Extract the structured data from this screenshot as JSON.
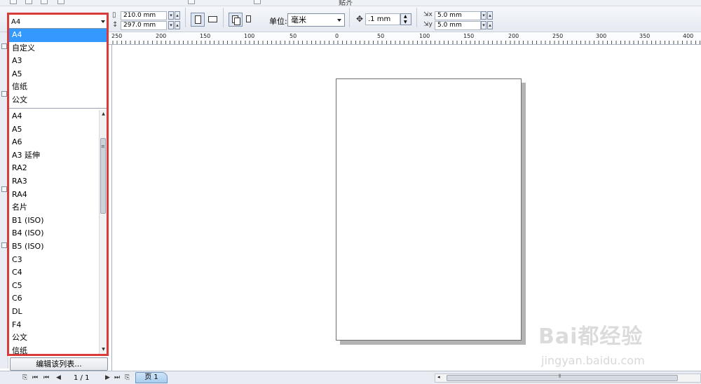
{
  "top_toolbar": {
    "partial_text": "贴齐"
  },
  "property_bar": {
    "paper_size_value": "A4",
    "width_value": "210.0 mm",
    "height_value": "297.0 mm",
    "units_label": "单位:",
    "units_value": "毫米",
    "nudge_value": ".1 mm",
    "dup_x_value": "5.0 mm",
    "dup_y_value": "5.0 mm"
  },
  "ruler": {
    "labels": [
      "250",
      "200",
      "150",
      "100",
      "50",
      "0",
      "50",
      "100",
      "150",
      "200",
      "250",
      "300",
      "350",
      "400"
    ]
  },
  "paper_dropdown": {
    "current_value": "A4",
    "recent_items": [
      {
        "label": "A4",
        "selected": true
      },
      {
        "label": "自定义",
        "selected": false
      },
      {
        "label": "A3",
        "selected": false
      },
      {
        "label": "A5",
        "selected": false
      },
      {
        "label": "信纸",
        "selected": false
      },
      {
        "label": "公文",
        "selected": false
      }
    ],
    "all_items": [
      "A4",
      "A5",
      "A6",
      "A3 延伸",
      "RA2",
      "RA3",
      "RA4",
      "名片",
      "B1 (ISO)",
      "B4 (ISO)",
      "B5 (ISO)",
      "C3",
      "C4",
      "C5",
      "C6",
      "DL",
      "F4",
      "公文",
      "信纸"
    ],
    "edit_list_label": "编辑该列表..."
  },
  "page_navigator": {
    "counter": "1 / 1",
    "page_tab_label": "页 1"
  },
  "watermark": {
    "logo_text": "Bai都经验",
    "url_text": "jingyan.baidu.com"
  },
  "colors": {
    "highlight": "#d93a3a",
    "selection": "#3399ff",
    "page_tab": "#a8cdef"
  }
}
